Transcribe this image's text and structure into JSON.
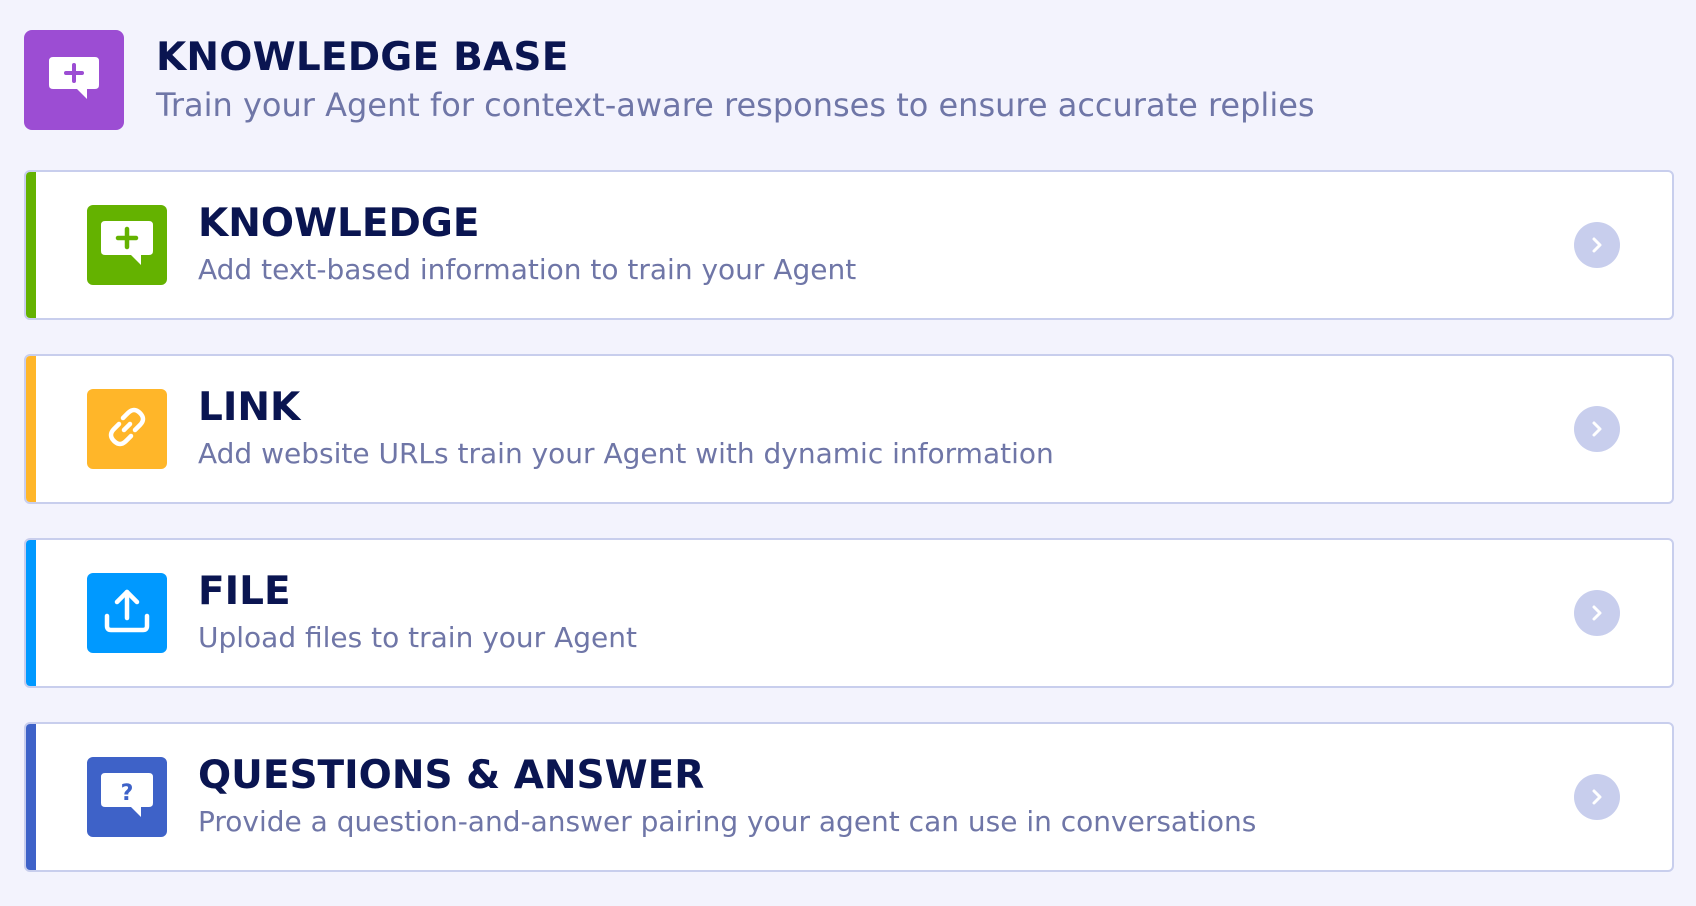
{
  "header": {
    "title": "KNOWLEDGE BASE",
    "subtitle": "Train your Agent for context-aware responses to ensure accurate replies",
    "icon": "chat-plus-icon",
    "icon_color": "#9c4dd3"
  },
  "cards": [
    {
      "title": "KNOWLEDGE",
      "description": "Add text-based information to train your Agent",
      "icon": "chat-plus-icon",
      "color": "#64b200"
    },
    {
      "title": "LINK",
      "description": "Add website URLs train your Agent with dynamic information",
      "icon": "link-icon",
      "color": "#ffb629"
    },
    {
      "title": "FILE",
      "description": "Upload files to train your Agent",
      "icon": "upload-icon",
      "color": "#0099ff"
    },
    {
      "title": "QUESTIONS & ANSWER",
      "description": "Provide a question-and-answer pairing your agent can use in conversations",
      "icon": "chat-question-icon",
      "color": "#3e62c8"
    }
  ],
  "colors": {
    "background": "#f3f3fd",
    "title": "#0a1551",
    "subtitle": "#6f76a7",
    "card_border": "#c8ceed",
    "arrow_bg": "#c8ceed"
  }
}
